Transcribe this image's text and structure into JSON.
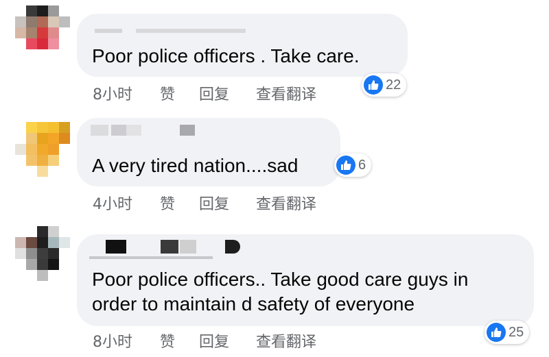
{
  "colors": {
    "bubble_bg": "#f0f2f5",
    "like_blue": "#1877f2",
    "meta_gray": "#65676b",
    "text": "#050505"
  },
  "comments": [
    {
      "text_lines": [
        "Poor police officers . Take care."
      ],
      "time": "8小时",
      "like_label": "赞",
      "reply_label": "回复",
      "translate_label": "查看翻译",
      "reaction_icon": "thumbs-up-icon",
      "reaction_count": "22"
    },
    {
      "text_lines": [
        "A very tired nation....sad"
      ],
      "time": "4小时",
      "like_label": "赞",
      "reply_label": "回复",
      "translate_label": "查看翻译",
      "reaction_icon": "thumbs-up-icon",
      "reaction_count": "6"
    },
    {
      "text_lines": [
        "Poor police officers.. Take good care guys in",
        "order to maintain d safety of everyone"
      ],
      "time": "8小时",
      "like_label": "赞",
      "reply_label": "回复",
      "translate_label": "查看翻译",
      "reaction_icon": "thumbs-up-icon",
      "reaction_count": "25"
    }
  ]
}
